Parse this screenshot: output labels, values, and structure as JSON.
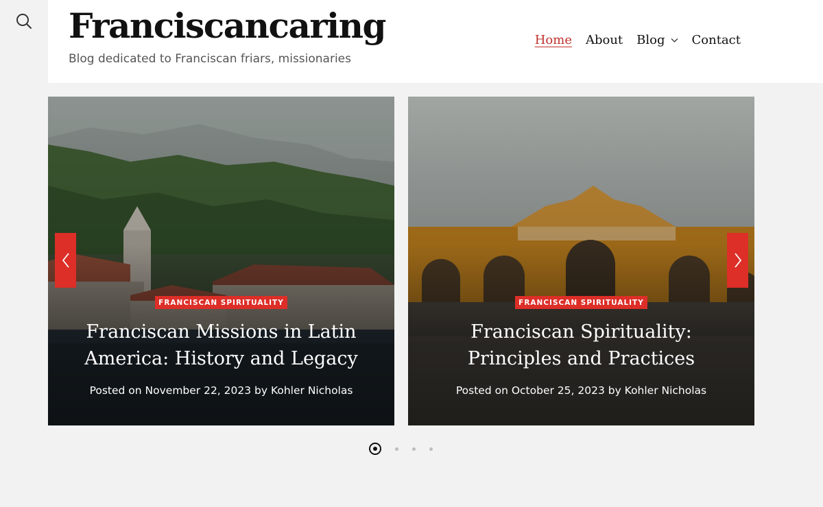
{
  "colors": {
    "accent": "#dd2e28",
    "active_nav": "#c0302b",
    "page_bg": "#f2f2f2",
    "header_bg": "#ffffff"
  },
  "search": {
    "icon": "search-icon"
  },
  "header": {
    "title": "Franciscancaring",
    "tagline": "Blog dedicated to Franciscan friars, missionaries"
  },
  "nav": {
    "items": [
      {
        "label": "Home",
        "active": true
      },
      {
        "label": "About",
        "active": false
      },
      {
        "label": "Blog",
        "active": false,
        "has_dropdown": true,
        "icon": "chevron-down-icon"
      },
      {
        "label": "Contact",
        "active": false
      }
    ]
  },
  "slider": {
    "prev_icon": "chevron-left-icon",
    "next_icon": "chevron-right-icon",
    "slides": [
      {
        "category": "FRANCISCAN SPIRITUALITY",
        "title": "Franciscan Missions in Latin America: History and Legacy",
        "meta": "Posted on November 22, 2023 by Kohler Nicholas"
      },
      {
        "category": "FRANCISCAN SPIRITUALITY",
        "title": "Franciscan Spirituality: Principles and Practices",
        "meta": "Posted on October 25, 2023 by Kohler Nicholas"
      }
    ],
    "pagination": {
      "total": 4,
      "current": 1
    }
  }
}
